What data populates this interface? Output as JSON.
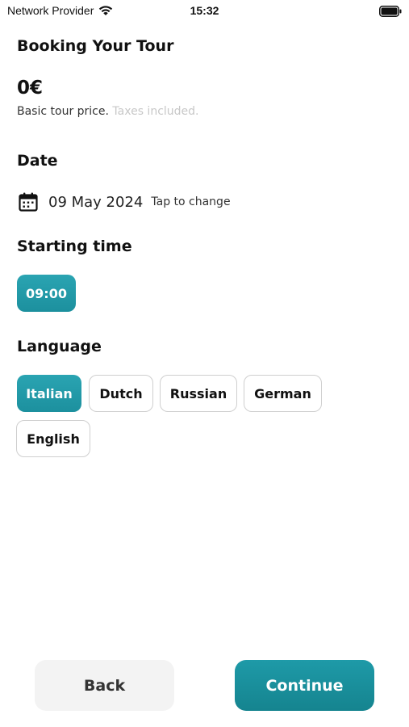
{
  "status_bar": {
    "carrier": "Network Provider",
    "time": "15:32",
    "wifi_icon": "wifi-icon",
    "battery_icon": "battery-icon"
  },
  "header": {
    "title": "Booking Your Tour"
  },
  "price": {
    "amount": "0€",
    "note": "Basic tour price.",
    "note_muted": "Taxes included."
  },
  "date": {
    "label": "Date",
    "icon": "calendar-icon",
    "value": "09 May 2024",
    "hint": "Tap to change"
  },
  "starting_time": {
    "label": "Starting time",
    "options": [
      {
        "label": "09:00",
        "selected": true
      }
    ]
  },
  "language": {
    "label": "Language",
    "options": [
      {
        "label": "Italian",
        "selected": true
      },
      {
        "label": "Dutch",
        "selected": false
      },
      {
        "label": "Russian",
        "selected": false
      },
      {
        "label": "German",
        "selected": false
      },
      {
        "label": "English",
        "selected": false
      }
    ]
  },
  "footer": {
    "back_label": "Back",
    "continue_label": "Continue"
  },
  "colors": {
    "accent": "#1e9aa8",
    "accent_light": "#2aa4b2",
    "muted_text": "#c8c8c8",
    "back_button_bg": "#f3f3f3"
  }
}
